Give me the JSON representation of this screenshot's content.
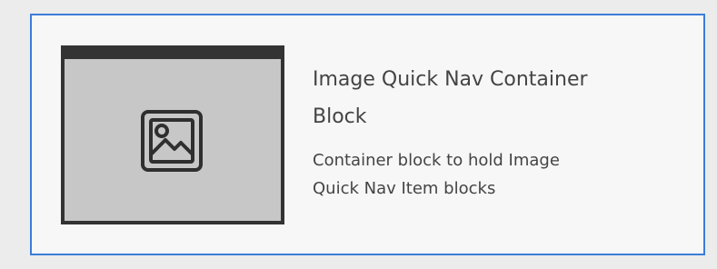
{
  "block": {
    "icon": "image-icon",
    "title_line1": "Image Quick Nav Container",
    "title_line2": "Block",
    "description_line1": "Container block to hold Image",
    "description_line2": "Quick Nav Item blocks"
  },
  "colors": {
    "selected_border": "#3c7dd9",
    "thumbnail_frame": "#333333",
    "thumbnail_fill": "#c7c7c7"
  }
}
